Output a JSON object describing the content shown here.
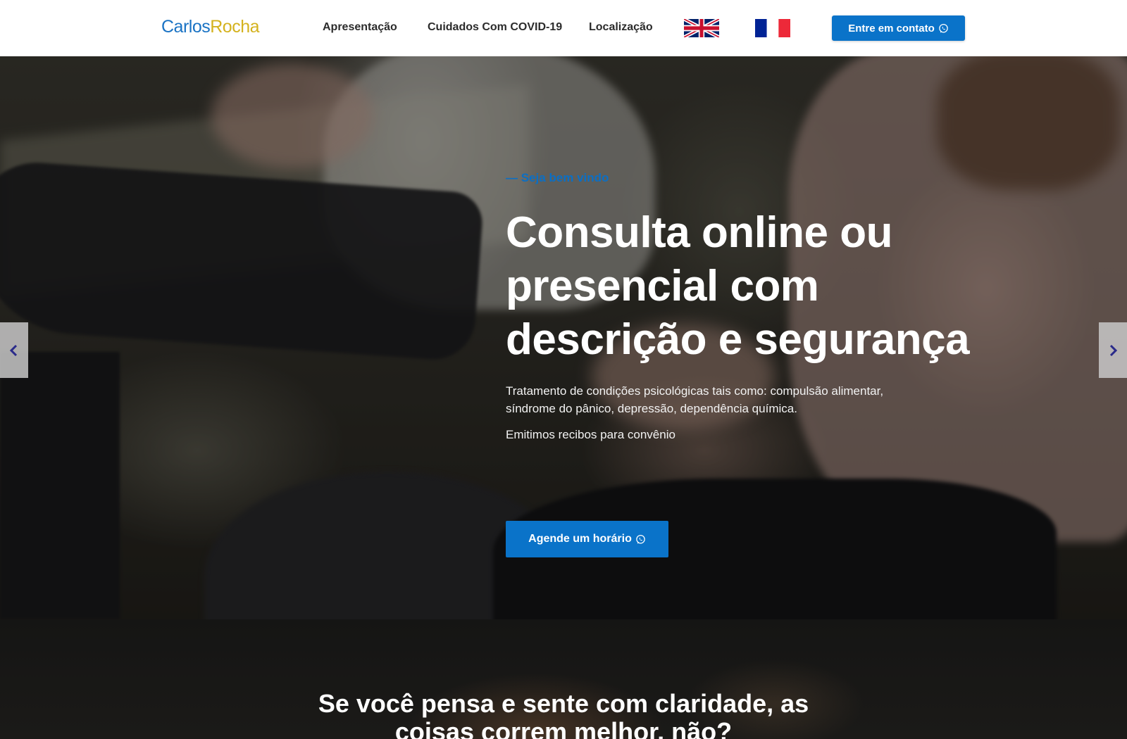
{
  "header": {
    "logo": {
      "first": "Carlos",
      "last": "Rocha"
    },
    "nav": [
      {
        "label": "Apresentação"
      },
      {
        "label": "Cuidados Com COVID-19"
      },
      {
        "label": "Localização"
      }
    ],
    "flags": [
      {
        "icon": "uk-flag-icon"
      },
      {
        "icon": "france-flag-icon"
      }
    ],
    "contact_button": {
      "label": "Entre em contato",
      "icon": "whatsapp-icon"
    }
  },
  "hero": {
    "tagline": "— Seja bem vindo",
    "headline": "Consulta online ou presencial com descrição e segurança",
    "description": "Tratamento de condições psicológicas tais como: compulsão alimentar, síndrome do pânico, depressão, dependência química.",
    "note": "Emitimos recibos para convênio",
    "cta": {
      "label": "Agende um horário",
      "icon": "whatsapp-icon"
    },
    "prev_icon": "chevron-left-icon",
    "next_icon": "chevron-right-icon"
  },
  "section2": {
    "title_line1": "Se você pensa e sente com claridade, as",
    "title_line2": "coisas correm melhor, não?"
  },
  "colors": {
    "accent": "#0a73c9",
    "logo_blue": "#1a73c4",
    "logo_gold": "#d4b21e",
    "arrow_chevron": "#2a2a8a"
  }
}
